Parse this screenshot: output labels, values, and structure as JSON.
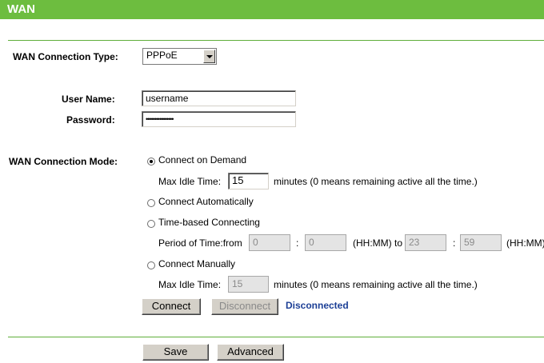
{
  "header": {
    "title": "WAN"
  },
  "connection_type": {
    "label": "WAN Connection Type:",
    "selected": "PPPoE"
  },
  "credentials": {
    "username_label": "User Name:",
    "username_value": "username",
    "password_label": "Password:",
    "password_value": "••••••••••••••••"
  },
  "mode": {
    "label": "WAN Connection Mode:",
    "connect_on_demand": "Connect on Demand",
    "max_idle_label": "Max Idle Time:",
    "max_idle_value": "15",
    "max_idle_suffix": "minutes (0 means remaining active all the time.)",
    "connect_automatically": "Connect Automatically",
    "time_based": "Time-based Connecting",
    "period_label": "Period of Time:from",
    "from_hh": "0",
    "colon": ":",
    "from_mm": "0",
    "hhmm_to": "(HH:MM) to",
    "to_hh": "23",
    "to_mm": "59",
    "hhmm": "(HH:MM)",
    "connect_manually": "Connect Manually",
    "manual_idle_label": "Max Idle Time:",
    "manual_idle_value": "15",
    "manual_idle_suffix": "minutes (0 means remaining active all the time.)"
  },
  "actions": {
    "connect": "Connect",
    "disconnect": "Disconnect",
    "status": "Disconnected",
    "save": "Save",
    "advanced": "Advanced"
  },
  "colors": {
    "header": "#6dbd3f",
    "status": "#1c3f96"
  }
}
